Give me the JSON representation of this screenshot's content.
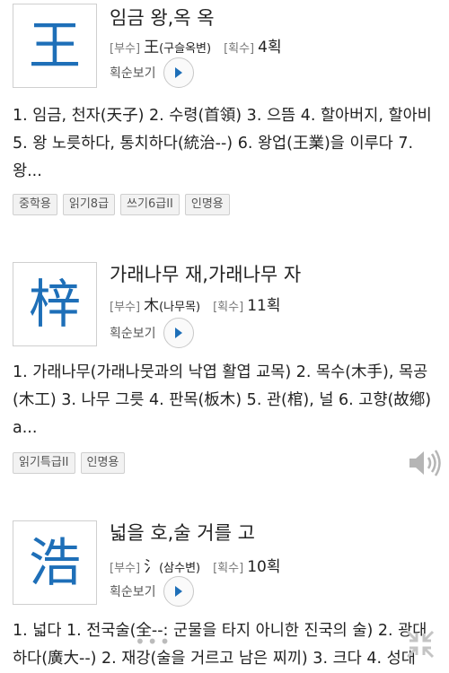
{
  "labels": {
    "radical_tag": "[부수]",
    "strokes_tag": "[획수]",
    "stroke_order": "획순보기"
  },
  "entries": [
    {
      "hanja": "王",
      "reading": "임금 왕,옥 옥",
      "radical": "王",
      "radical_name": "(구슬옥변)",
      "strokes": "4획",
      "meaning": "1. 임금, 천자(天子) 2. 수령(首領) 3. 으뜸 4. 할아버지, 할아비 5. 왕 노릇하다, 통치하다(統治--) 6. 왕업(王業)을 이루다 7. 왕...",
      "badges": [
        "중학용",
        "읽기8급",
        "쓰기6급II",
        "인명용"
      ]
    },
    {
      "hanja": "梓",
      "reading": "가래나무 재,가래나무 자",
      "radical": "木",
      "radical_name": "(나무목)",
      "strokes": "11획",
      "meaning": "1. 가래나무(가래나뭇과의 낙엽 활엽 교목) 2. 목수(木手), 목공(木工) 3. 나무 그릇 4. 판목(板木) 5. 관(棺), 널 6. 고향(故鄕) a...",
      "badges": [
        "읽기특급II",
        "인명용"
      ]
    },
    {
      "hanja": "浩",
      "reading": "넓을 호,술 거를 고",
      "radical": "氵",
      "radical_name": "(삼수변)",
      "strokes": "10획",
      "meaning": "1. 넓다 1. 전국술(全--: 군물을 타지 아니한 진국의 술) 2. 광대하다(廣大--) 2. 재강(술을 거르고 남은 찌끼) 3. 크다 4. 성대",
      "badges": []
    }
  ],
  "colors": {
    "hanja": "#1e6fb8",
    "text": "#222222",
    "muted": "#777777"
  }
}
